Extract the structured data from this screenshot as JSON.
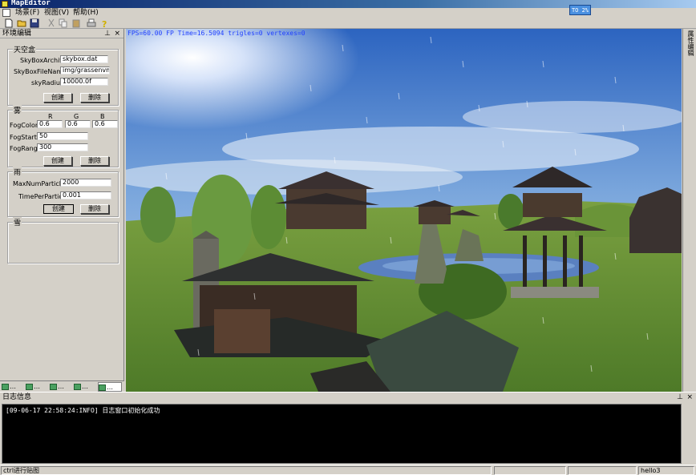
{
  "window": {
    "title": "MapEditor",
    "fps_badge": "TO 2%"
  },
  "menu": {
    "items": [
      {
        "label": "场景(F)"
      },
      {
        "label": "视图(V)"
      },
      {
        "label": "帮助(H)"
      }
    ]
  },
  "toolbar": {
    "icons": [
      "new-icon",
      "open-icon",
      "save-icon",
      "cut-icon",
      "copy-icon",
      "paste-icon",
      "print-icon",
      "help-icon"
    ]
  },
  "left_dock": {
    "title": "环境编辑",
    "skybox": {
      "title": "天空盒",
      "archive_label": "SkyBoxArchive",
      "archive_value": "skybox.dat",
      "filename_label": "SkyBoxFileName",
      "filename_value": "img/grassenvmap",
      "radius_label": "skyRadius",
      "radius_value": "10000.0f",
      "create_label": "创建",
      "delete_label": "删除"
    },
    "fog": {
      "title": "雾",
      "col_r": "R",
      "col_g": "G",
      "col_b": "B",
      "color_label": "FogColor",
      "r": "0.6",
      "g": "0.6",
      "b": "0.6",
      "start_label": "FogStart",
      "start_value": "50",
      "range_label": "FogRange",
      "range_value": "300",
      "create_label": "创建",
      "delete_label": "删除"
    },
    "rain": {
      "title": "雨",
      "maxnum_label": "MaxNumParticles",
      "maxnum_value": "2000",
      "time_label": "TimePerParticle",
      "time_value": "0.001",
      "create_label": "创建",
      "delete_label": "删除"
    },
    "snow": {
      "title": "雪"
    },
    "tabs": [
      {
        "label": "…"
      },
      {
        "label": "…"
      },
      {
        "label": "…"
      },
      {
        "label": "…"
      },
      {
        "label": "…"
      }
    ]
  },
  "viewport": {
    "hud": "FPS=60.00  FP Time=16.5094  trigles=0  vertexes=0"
  },
  "right_strip": {
    "tab_label": "属性编辑"
  },
  "log": {
    "title": "日志信息",
    "lines": [
      "[09-06-17 22:58:24:INFO] 日志窗口初始化成功"
    ]
  },
  "statusbar": {
    "left": "ctrl进行贴图",
    "right": "hello3"
  },
  "colors": {
    "hud": "#2040ff",
    "title_gradient_start": "#0a246a",
    "panel": "#d4d0c8"
  }
}
